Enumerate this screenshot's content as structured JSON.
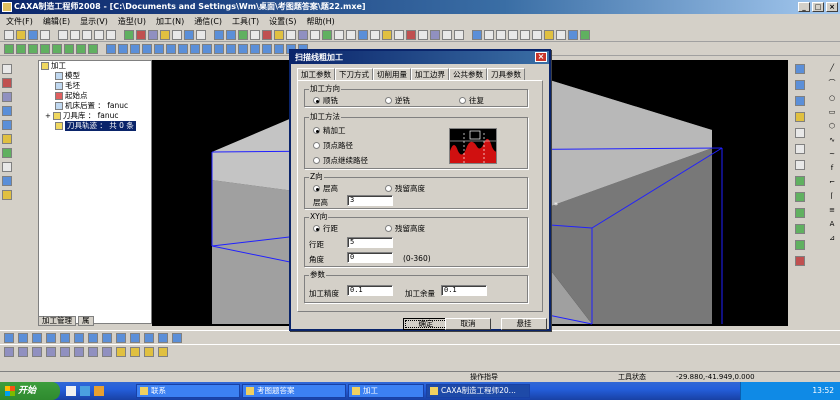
{
  "window": {
    "title": "CAXA制造工程师2008 - [C:\\Documents and Settings\\Wm\\桌面\\考图题答案\\题22.mxe]"
  },
  "menu": {
    "items": [
      "文件(F)",
      "编辑(E)",
      "显示(V)",
      "造型(U)",
      "加工(N)",
      "通信(C)",
      "工具(T)",
      "设置(S)",
      "帮助(H)"
    ]
  },
  "tree": {
    "root": "加工",
    "items": [
      "模型",
      "毛坯",
      "起始点",
      "机床后置 ： fanuc",
      "刀具库 ： fanuc",
      "刀具轨迹 ： 共 0 条"
    ],
    "tabs": [
      "加工管理",
      "属"
    ]
  },
  "dialog": {
    "title": "扫描线粗加工",
    "close": "×",
    "tabs": [
      "加工参数",
      "下刀方式",
      "切削用量",
      "加工边界",
      "公共参数",
      "刀具参数"
    ],
    "direction": {
      "label": "加工方向",
      "options": [
        "顺铣",
        "逆铣",
        "往复"
      ],
      "selected": "顺铣"
    },
    "method": {
      "label": "加工方法",
      "options": [
        "精加工",
        "顶点路径",
        "顶点继续路径"
      ],
      "selected": "精加工"
    },
    "z": {
      "label": "Z向",
      "options": [
        "层高",
        "残留高度"
      ],
      "selected": "层高",
      "layer_label": "层高",
      "layer_value": "3"
    },
    "xy": {
      "label": "XY向",
      "options": [
        "行距",
        "残留高度"
      ],
      "selected": "行距",
      "step_label": "行距",
      "step_value": "5",
      "angle_label": "角度",
      "angle_value": "0",
      "angle_range": "(0-360)"
    },
    "params": {
      "label": "参数",
      "precision_label": "加工精度",
      "precision_value": "0.1",
      "allowance_label": "加工余量",
      "allowance_value": "0.1"
    },
    "buttons": {
      "ok": "确定",
      "cancel": "取消",
      "suspend": "悬挂"
    }
  },
  "status": {
    "prompt": "操作指导",
    "tool_state": "工具状态",
    "coords": "-29.880,-41.949,0.000"
  },
  "taskbar": {
    "start": "开始",
    "tasks": [
      "联系",
      "考图题答案",
      "加工",
      "CAXA制造工程师20..."
    ],
    "clock": "13:52"
  },
  "colors": {
    "title_bg": "#0a246a",
    "viewport_bg": "#000000",
    "wire": "#2020ff",
    "taskbar": "#245edb"
  }
}
